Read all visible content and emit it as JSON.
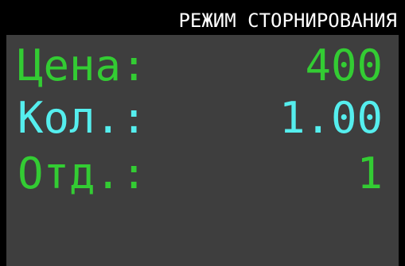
{
  "header": {
    "mode_text": "РЕЖИМ СТОРНИРОВАНИЯ"
  },
  "fields": {
    "price": {
      "label": "Цена:",
      "value": "400"
    },
    "quantity": {
      "label": "Кол.:",
      "value": "1.00"
    },
    "department": {
      "label": "Отд.:",
      "value": "1"
    }
  },
  "colors": {
    "background": "#3e3e3e",
    "header_background": "#000000",
    "header_text": "#ffffff",
    "price_text": "#33cc33",
    "quantity_text": "#55eeee",
    "department_text": "#33cc33"
  }
}
